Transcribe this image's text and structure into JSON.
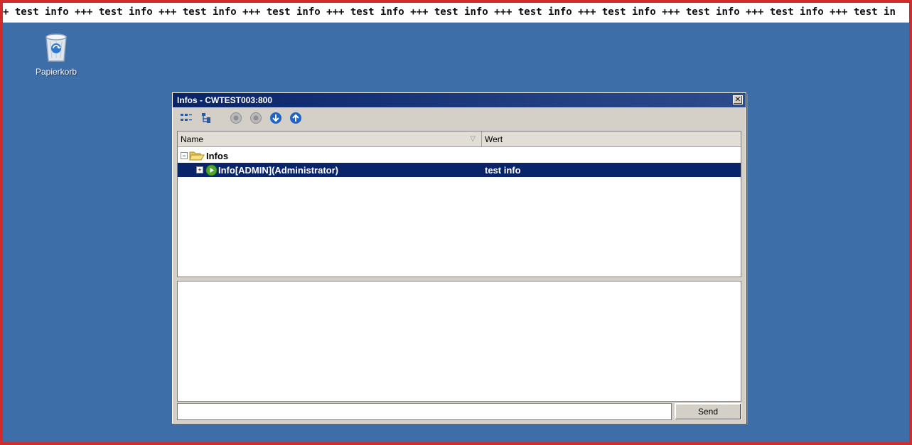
{
  "ticker": {
    "text": "+ test info +++ test info +++ test info +++ test info +++ test info +++ test info +++ test info +++ test info +++ test info +++ test info +++ test in"
  },
  "desktop": {
    "icons": [
      {
        "label": "Papierkorb",
        "icon": "recycle-bin-icon"
      }
    ]
  },
  "window": {
    "title": "Infos - CWTEST003:800",
    "close_glyph": "✕",
    "toolbar": [
      "collapse-all-icon",
      "expand-all-icon",
      "disabled-circle-icon",
      "disabled-circle-icon",
      "arrow-down-icon",
      "arrow-up-icon"
    ],
    "columns": {
      "name": "Name",
      "sort_glyph": "▽",
      "wert": "Wert"
    },
    "tree": {
      "root": {
        "label": "Infos",
        "expander": "−"
      },
      "rows": [
        {
          "label": "Info[ADMIN](Administrator)",
          "value": "test info",
          "expander": "+",
          "selected": true
        }
      ]
    },
    "input": {
      "value": "",
      "placeholder": ""
    },
    "send_label": "Send"
  },
  "colors": {
    "desktop": "#3d6ea8",
    "frame": "#d32b2b",
    "title_bar": "#0a246a",
    "selection": "#0a246a",
    "accent_blue": "#1f63c9"
  }
}
